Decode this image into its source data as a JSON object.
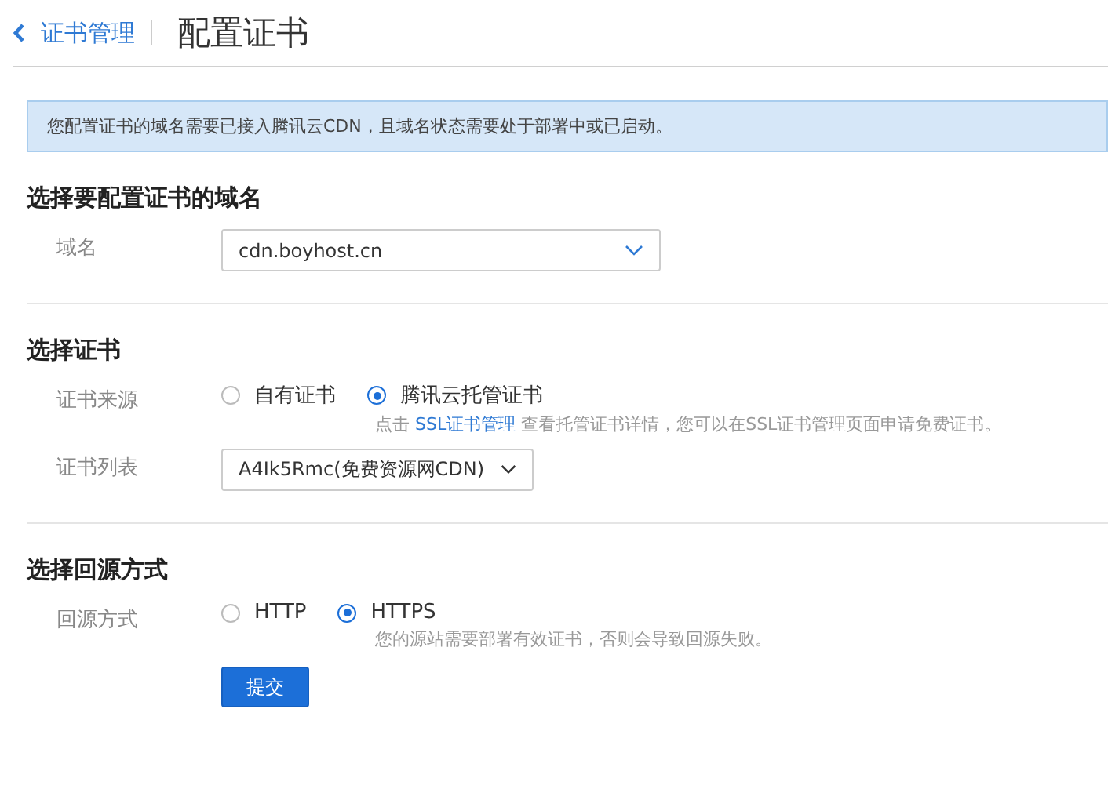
{
  "header": {
    "back_link": "证书管理",
    "title": "配置证书"
  },
  "notice": "您配置证书的域名需要已接入腾讯云CDN，且域名状态需要处于部署中或已启动。",
  "sections": [
    {
      "title": "选择要配置证书的域名",
      "fields": [
        {
          "kind": "select",
          "label": "域名",
          "value": "cdn.boyhost.cn",
          "wide": true
        }
      ]
    },
    {
      "title": "选择证书",
      "fields": [
        {
          "kind": "radio",
          "label": "证书来源",
          "options": [
            {
              "label": "自有证书",
              "selected": false
            },
            {
              "label": "腾讯云托管证书",
              "selected": true
            }
          ],
          "hint": {
            "before": "点击 ",
            "link": "SSL证书管理",
            "after": " 查看托管证书详情，您可以在SSL证书管理页面申请免费证书。"
          }
        },
        {
          "kind": "select",
          "label": "证书列表",
          "value": "A4Ik5Rmc(免费资源网CDN)",
          "wide": false
        }
      ]
    },
    {
      "title": "选择回源方式",
      "fields": [
        {
          "kind": "radio",
          "label": "回源方式",
          "options": [
            {
              "label": "HTTP",
              "selected": false
            },
            {
              "label": "HTTPS",
              "selected": true
            }
          ],
          "hint": {
            "before": "您的源站需要部署有效证书，否则会导致回源失败。"
          }
        }
      ]
    }
  ],
  "submit": "提交"
}
